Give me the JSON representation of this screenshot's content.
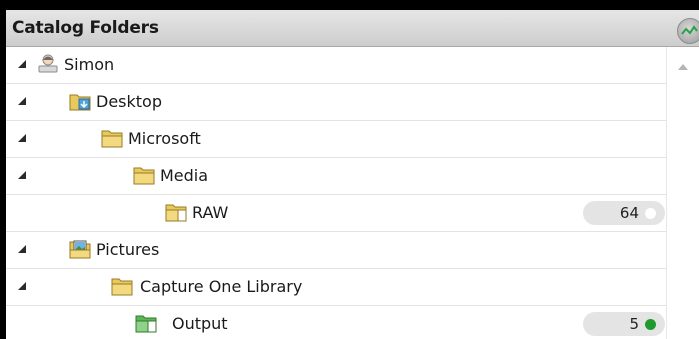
{
  "panel": {
    "title": "Catalog Folders"
  },
  "tree": [
    {
      "label": "Simon",
      "icon": "user-computer-icon",
      "count": ""
    },
    {
      "label": "Desktop",
      "icon": "desktop-folder-icon",
      "count": ""
    },
    {
      "label": "Microsoft",
      "icon": "folder-icon",
      "count": ""
    },
    {
      "label": "Media",
      "icon": "folder-icon",
      "count": ""
    },
    {
      "label": "RAW",
      "icon": "folder-open-icon",
      "count": "64",
      "status": "empty"
    },
    {
      "label": "Pictures",
      "icon": "pictures-folder-icon",
      "count": ""
    },
    {
      "label": "Capture One Library",
      "icon": "folder-icon",
      "count": ""
    },
    {
      "label": "Output",
      "icon": "output-folder-icon",
      "count": "5",
      "status": "green"
    }
  ],
  "colors": {
    "folder": "#e8c95c",
    "output_folder": "#5db55a",
    "status_green": "#1f9a2e"
  }
}
